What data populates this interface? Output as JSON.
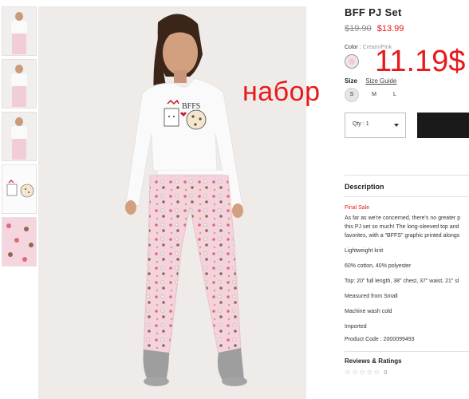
{
  "product": {
    "title": "BFF PJ Set",
    "old_price": "$19.90",
    "new_price": "$13.99",
    "color_label": "Color :",
    "color_value": "Cream/Pink",
    "size_label": "Size",
    "size_guide": "Size Guide",
    "sizes": [
      "S",
      "M",
      "L"
    ],
    "selected_size": "S",
    "qty_label": "Qty : 1"
  },
  "overlay": {
    "russian_text": "набор",
    "price_text": "11.19$"
  },
  "hero": {
    "shirt_text": "BFFS"
  },
  "description": {
    "heading": "Description",
    "final_sale": "Final Sale",
    "body_lines": [
      "As far as we're concerned, there's no greater p",
      "this PJ set so much! The long-sleeved top and",
      "favorites, with a \"BFFS\" graphic printed alongs"
    ],
    "specs": [
      "Lightweight knit",
      "60% cotton, 40% polyester",
      "Top: 20\" full length, 38\" chest, 37\" waist, 21\" sl",
      "Measured from Small",
      "Machine wash cold",
      "Imported",
      "Product Code : 2000099493"
    ]
  },
  "reviews": {
    "heading": "Reviews & Ratings",
    "stars": "☆☆☆☆☆",
    "count": "0"
  },
  "colors": {
    "sale_red": "#e8191b",
    "pajama_pink": "#f4d3dc",
    "shirt_white": "#fafafa",
    "button_black": "#1a1a1a"
  }
}
